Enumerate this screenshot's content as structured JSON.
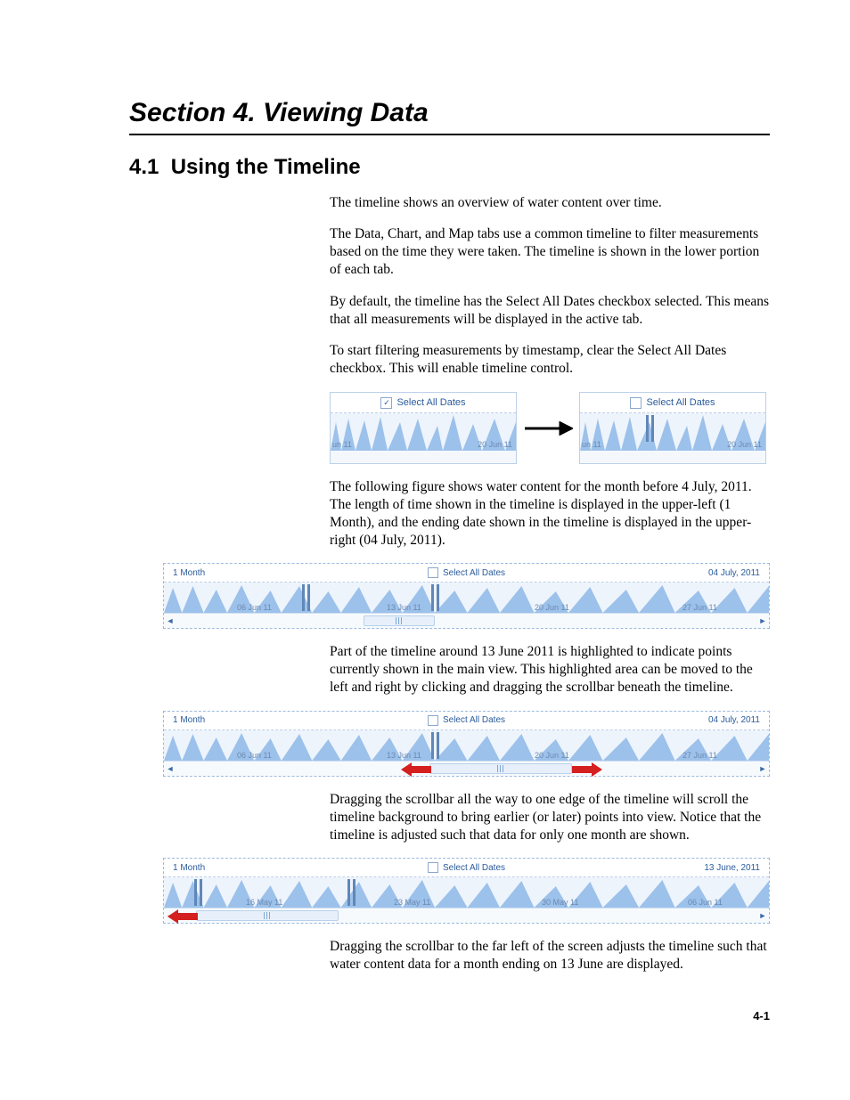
{
  "section": {
    "title": "Section 4.    Viewing Data"
  },
  "subsection": {
    "number": "4.1",
    "title": "Using the Timeline"
  },
  "paragraphs": {
    "p1": "The timeline shows an overview of water content over time.",
    "p2": "The Data, Chart, and Map tabs use a common timeline to filter measurements based on the time they were taken.  The timeline is shown in the lower portion of each tab.",
    "p3": "By default, the timeline has the Select All Dates checkbox selected.  This means that all measurements will be displayed in the active tab.",
    "p4": "To start filtering measurements by timestamp, clear the Select All Dates checkbox.  This will enable timeline control.",
    "p5": "The following figure shows water content for the month before 4 July, 2011.  The length of time shown in the timeline is displayed in the upper-left (1 Month), and the ending date shown in the timeline is displayed in the upper-right (04 July, 2011).",
    "p6": "Part of the timeline around 13 June 2011 is highlighted to indicate points currently shown in the main view.  This highlighted area can be moved to the left and right by clicking and dragging the scrollbar beneath the timeline.",
    "p7": "Dragging the scrollbar all the way to one edge of the timeline will scroll the timeline background to bring earlier (or later) points into view.  Notice that the timeline is adjusted such that data for only one month are shown.",
    "p8": "Dragging the scrollbar to the far left of the screen adjusts the timeline such that water content data for a month ending on 13 June are displayed."
  },
  "small_panels": {
    "checkbox_label": "Select All Dates",
    "left_checked": "✓",
    "axis_left": "un 11",
    "axis_right": "20 Jun 11"
  },
  "timeline1": {
    "range_label": "1 Month",
    "checkbox_label": "Select All Dates",
    "end_date": "04 July, 2011",
    "ticks": [
      "06 Jun 11",
      "13 Jun 11",
      "20 Jun 11",
      "27 Jun 11"
    ]
  },
  "timeline2": {
    "range_label": "1 Month",
    "checkbox_label": "Select All Dates",
    "end_date": "04 July, 2011",
    "ticks": [
      "06 Jun 11",
      "13 Jun 11",
      "20 Jun 11",
      "27 Jun 11"
    ]
  },
  "timeline3": {
    "range_label": "1 Month",
    "checkbox_label": "Select All Dates",
    "end_date": "13 June, 2011",
    "ticks": [
      "16 May 11",
      "23 May 11",
      "30 May 11",
      "06 Jun 11"
    ]
  },
  "page_number": "4-1"
}
